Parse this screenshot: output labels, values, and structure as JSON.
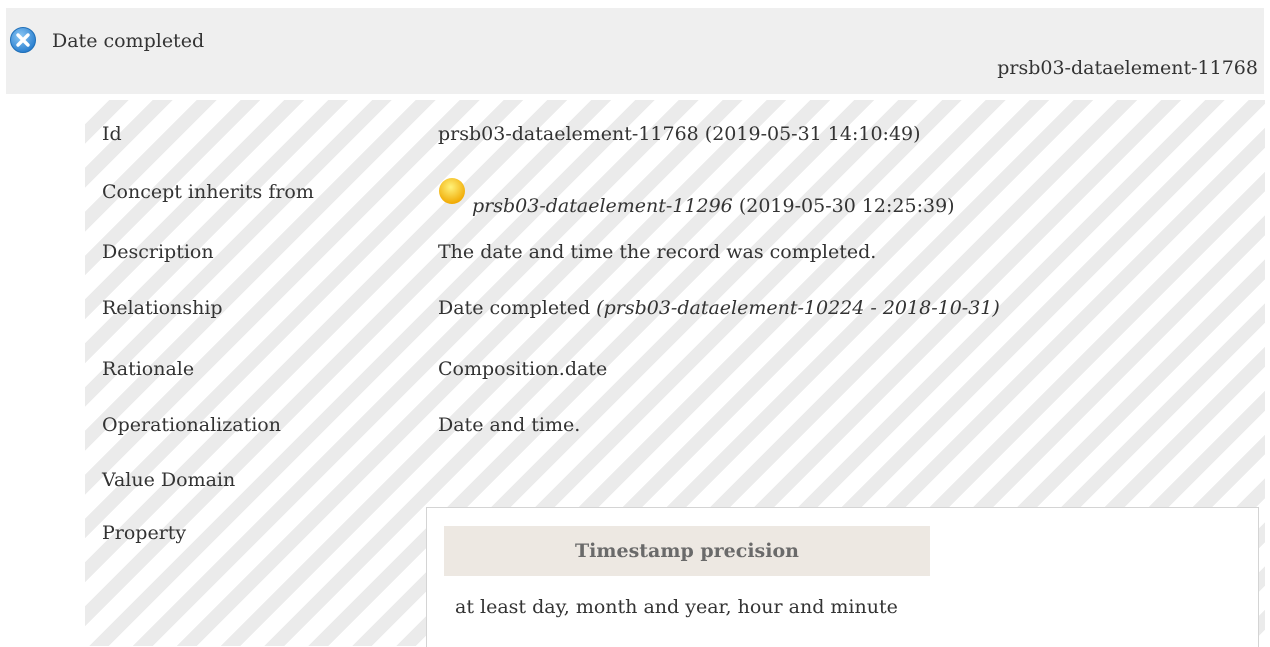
{
  "header": {
    "title": "Date completed",
    "id": "prsb03-dataelement-11768",
    "icon": "close-circle-icon"
  },
  "rows": {
    "id": {
      "label": "Id",
      "value": "prsb03-dataelement-11768 (2019-05-31 14:10:49)"
    },
    "inherits": {
      "label": "Concept inherits from",
      "icon": "status-dot-icon",
      "ref": "prsb03-dataelement-11296",
      "date": "(2019-05-30 12:25:39)"
    },
    "description": {
      "label": "Description",
      "value": "The date and time the record was completed."
    },
    "relationship": {
      "label": "Relationship",
      "value": "Date completed",
      "ref": "(prsb03-dataelement-10224 - 2018-10-31)"
    },
    "rationale": {
      "label": "Rationale",
      "value": "Composition.date"
    },
    "operationalization": {
      "label": "Operationalization",
      "value": "Date and time."
    },
    "value_domain": {
      "label": "Value Domain"
    },
    "property": {
      "label": "Property",
      "column_header": "Timestamp precision",
      "value": "at least day, month and year, hour and minute"
    }
  },
  "colors": {
    "header_bg": "#efefef",
    "stripe_light": "#ffffff",
    "stripe_dark": "#ebebeb",
    "icon_blue": "#3a8fd6",
    "dot_yellow": "#f5b800",
    "prop_header_bg": "#ede8e2"
  }
}
